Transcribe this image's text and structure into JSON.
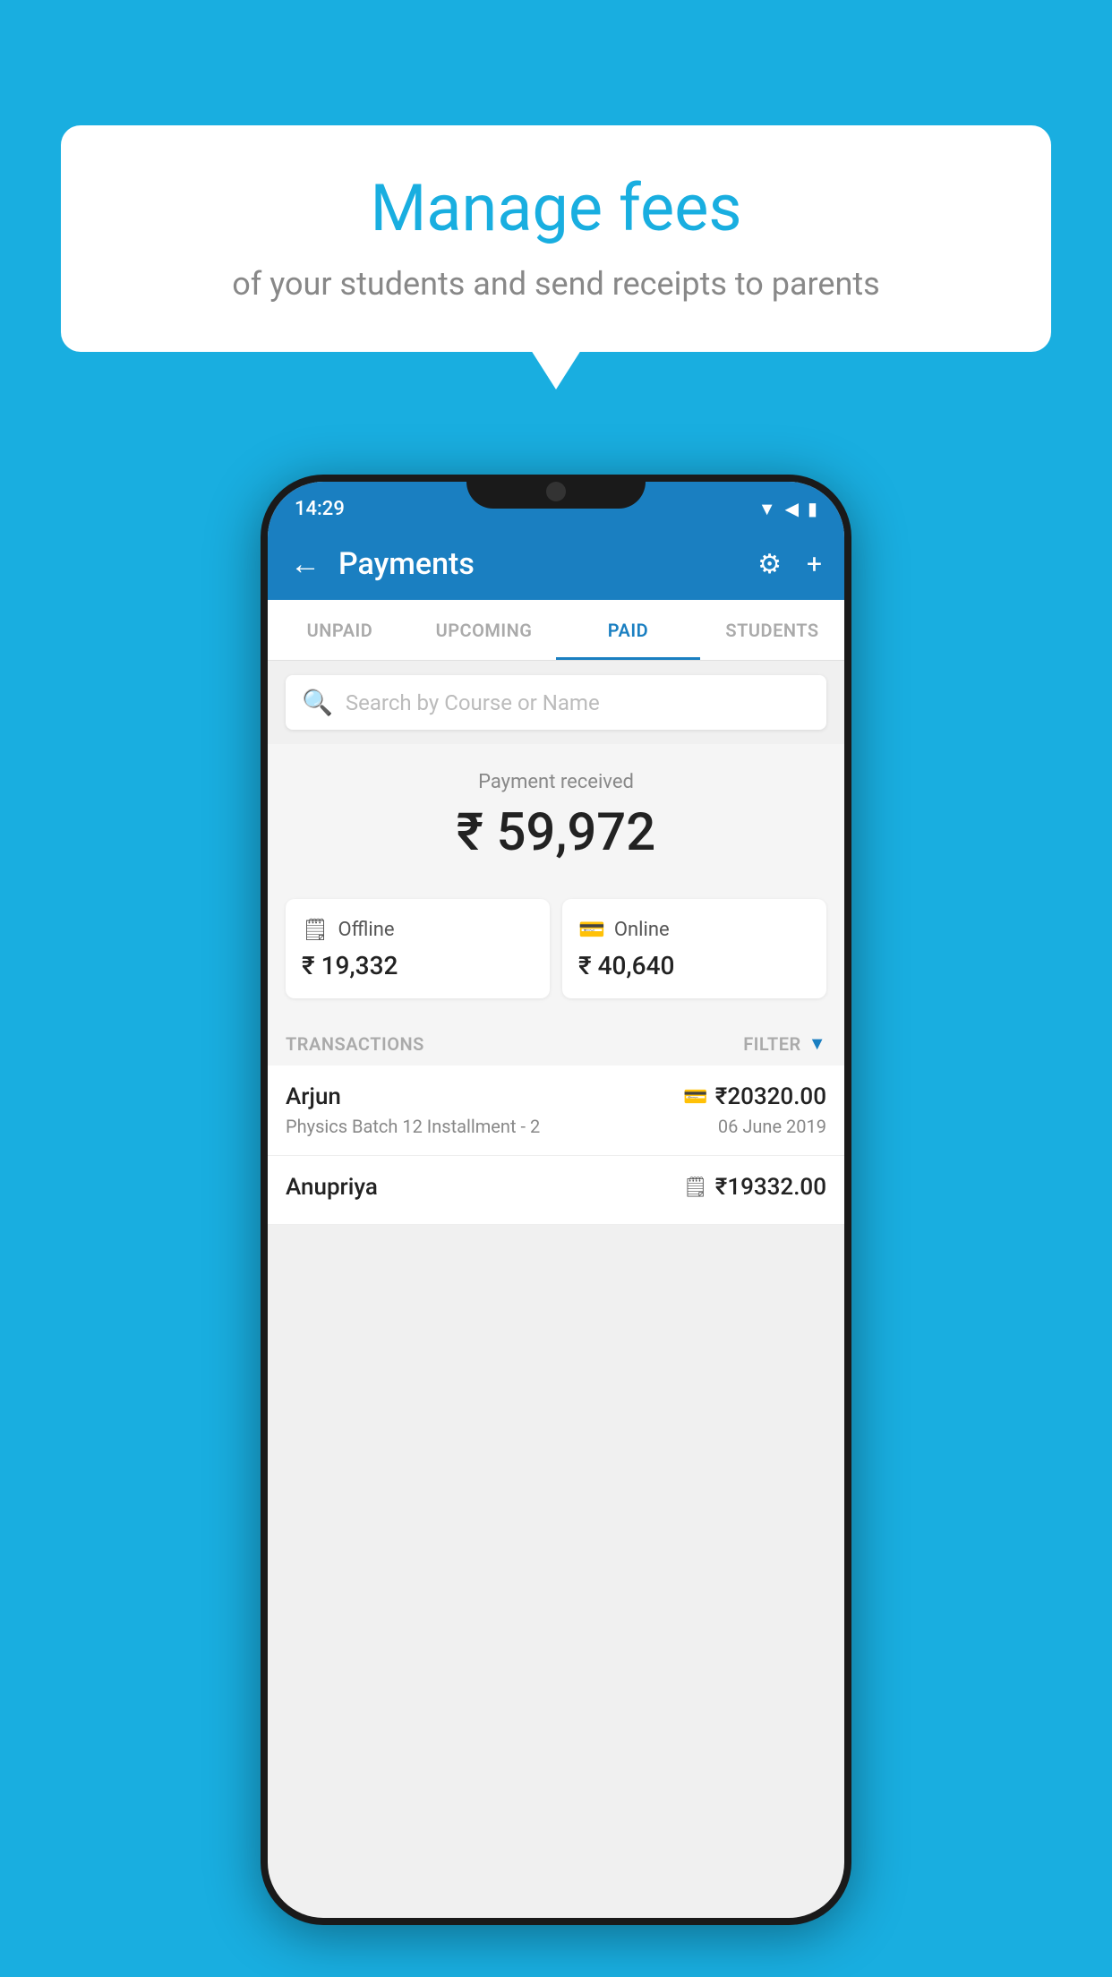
{
  "background_color": "#19aee0",
  "speech_bubble": {
    "title": "Manage fees",
    "subtitle": "of your students and send receipts to parents"
  },
  "status_bar": {
    "time": "14:29",
    "icons": "▼◀▮"
  },
  "app_bar": {
    "back_icon": "←",
    "title": "Payments",
    "settings_icon": "⚙",
    "add_icon": "+"
  },
  "tabs": [
    {
      "label": "UNPAID",
      "active": false
    },
    {
      "label": "UPCOMING",
      "active": false
    },
    {
      "label": "PAID",
      "active": true
    },
    {
      "label": "STUDENTS",
      "active": false
    }
  ],
  "search": {
    "placeholder": "Search by Course or Name",
    "search_icon": "🔍"
  },
  "payment_received": {
    "label": "Payment received",
    "amount": "₹ 59,972",
    "offline": {
      "label": "Offline",
      "amount": "₹ 19,332"
    },
    "online": {
      "label": "Online",
      "amount": "₹ 40,640"
    }
  },
  "transactions": {
    "header_label": "TRANSACTIONS",
    "filter_label": "FILTER",
    "items": [
      {
        "name": "Arjun",
        "detail": "Physics Batch 12 Installment - 2",
        "amount": "₹20320.00",
        "date": "06 June 2019",
        "payment_type": "online"
      },
      {
        "name": "Anupriya",
        "detail": "",
        "amount": "₹19332.00",
        "date": "",
        "payment_type": "offline"
      }
    ]
  }
}
